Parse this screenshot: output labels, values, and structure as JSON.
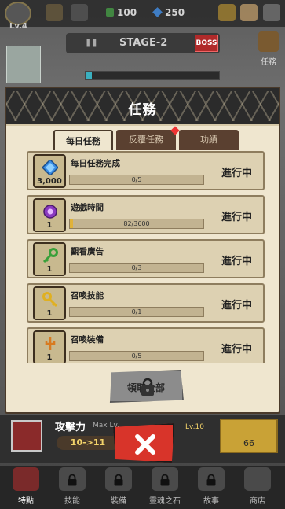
{
  "hud": {
    "level": "Lv.4",
    "gems": "100",
    "diamonds": "250"
  },
  "stage": {
    "name": "STAGE-2",
    "boss_label": "BOSS",
    "quest_label": "任務"
  },
  "modal": {
    "title": "任務",
    "tabs": [
      {
        "label": "每日任務",
        "active": true
      },
      {
        "label": "反覆任務",
        "active": false,
        "has_alert": true
      },
      {
        "label": "功績",
        "active": false
      }
    ],
    "quests": [
      {
        "name": "每日任務完成",
        "reward_count": "3,000",
        "reward_icon": "diamond-icon",
        "progress_text": "0/5",
        "progress": 0.0,
        "status": "進行中"
      },
      {
        "name": "遊戲時間",
        "reward_count": "1",
        "reward_icon": "purple-gem-orb-icon",
        "progress_text": "82/3600",
        "progress": 0.023,
        "status": "進行中"
      },
      {
        "name": "觀看廣告",
        "reward_count": "1",
        "reward_icon": "green-key-icon",
        "progress_text": "0/3",
        "progress": 0.0,
        "status": "進行中"
      },
      {
        "name": "召喚技能",
        "reward_count": "1",
        "reward_icon": "gold-key-icon",
        "progress_text": "0/1",
        "progress": 0.0,
        "status": "進行中"
      },
      {
        "name": "召喚裝備",
        "reward_count": "1",
        "reward_icon": "orange-key-icon",
        "progress_text": "0/5",
        "progress": 0.0,
        "status": "進行中"
      }
    ],
    "claim_all_label": "領取全部"
  },
  "stat": {
    "label": "攻擊力",
    "max_lv": "Max Lv.",
    "range": "10->11",
    "lv_next": "Lv.10",
    "gold": "66"
  },
  "nav": [
    {
      "label": "特點",
      "active": true,
      "locked": false
    },
    {
      "label": "技能",
      "active": false,
      "locked": true
    },
    {
      "label": "裝備",
      "active": false,
      "locked": true
    },
    {
      "label": "靈魂之石",
      "active": false,
      "locked": true
    },
    {
      "label": "故事",
      "active": false,
      "locked": true
    },
    {
      "label": "商店",
      "active": false,
      "locked": false
    }
  ],
  "colors": {
    "modal_bg": "#efe6cf",
    "progress_fill": "#e0b23a",
    "close_button": "#d8342a"
  }
}
